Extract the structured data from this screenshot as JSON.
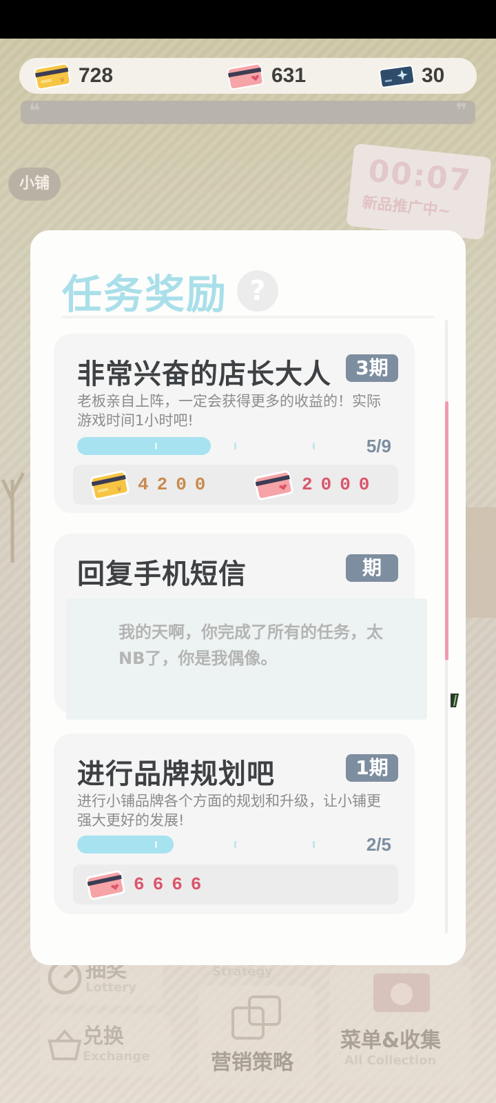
{
  "currencies": [
    {
      "icon": "gold-card-icon",
      "value": "728"
    },
    {
      "icon": "pink-card-icon",
      "value": "631"
    },
    {
      "icon": "blue-ticket-icon",
      "value": "30"
    }
  ],
  "quote": {
    "open": "❝",
    "close": "❞"
  },
  "background": {
    "shop_tag": "小铺",
    "promo_timer": "00:07",
    "promo_text": "新品推广中~"
  },
  "bottom_menu": {
    "lottery": {
      "title": "抽奖",
      "sub": "Lottery"
    },
    "marketing_strategy": {
      "title": "营销策略",
      "sub": "Marketing Strategy"
    },
    "exchange": {
      "title": "兑换",
      "sub": "Exchange"
    },
    "menu_collection": {
      "title": "菜单&收集",
      "sub": "All Collection"
    }
  },
  "modal": {
    "title": "任务奖励",
    "help": "?",
    "tasks": [
      {
        "title": "非常兴奋的店长大人",
        "period": "3期",
        "description": "老板亲自上阵，一定会获得更多的收益的！实际游戏时间1小时吧!",
        "progress_current": 5,
        "progress_total": 9,
        "progress_text": "5/9",
        "rewards": [
          {
            "icon": "gold-card-icon",
            "amount": "4200",
            "color": "#c98a4e"
          },
          {
            "icon": "pink-card-icon",
            "amount": "2000",
            "color": "#d9566b"
          }
        ]
      },
      {
        "title": "回复手机短信",
        "period": "期",
        "message": "我的天啊，你完成了所有的任务，太NB了，你是我偶像。"
      },
      {
        "title": "进行品牌规划吧",
        "period": "1期",
        "description": "进行小铺品牌各个方面的规划和升级，让小铺更强大更好的发展!",
        "progress_current": 2,
        "progress_total": 5,
        "progress_text": "2/5",
        "rewards": [
          {
            "icon": "pink-card-icon",
            "amount": "6666",
            "color": "#d9566b"
          }
        ]
      }
    ]
  },
  "colors": {
    "title_accent": "#a9dfe9",
    "period_badge": "#7d8ea0",
    "progress_fill": "#a6e2ef",
    "scroll_thumb": "#f39aaf"
  }
}
